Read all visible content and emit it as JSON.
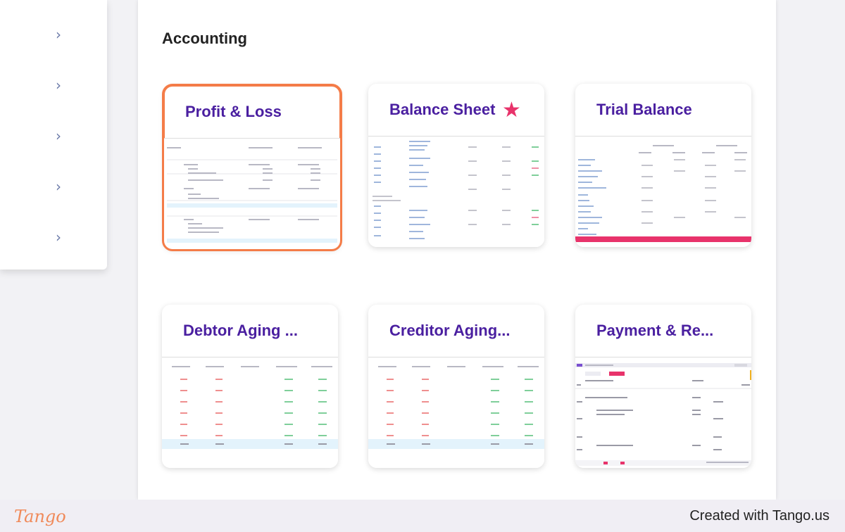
{
  "section": {
    "title": "Accounting"
  },
  "sidebar": {
    "chevron_glyph": "›",
    "chevron_icon": "chevron-right-icon",
    "count": 5
  },
  "cards": [
    {
      "name": "profit-loss",
      "title": "Profit & Loss",
      "selected": true,
      "starred": false
    },
    {
      "name": "balance-sheet",
      "title": "Balance Sheet",
      "selected": false,
      "starred": true
    },
    {
      "name": "trial-balance",
      "title": "Trial Balance",
      "selected": false,
      "starred": false
    },
    {
      "name": "debtor-aging",
      "title": "Debtor Aging ...",
      "selected": false,
      "starred": false
    },
    {
      "name": "creditor-aging",
      "title": "Creditor Aging...",
      "selected": false,
      "starred": false
    },
    {
      "name": "payment-receipt",
      "title": "Payment & Re...",
      "selected": false,
      "starred": false
    }
  ],
  "star_glyph": "★",
  "footer": {
    "brand": "Tango",
    "credit": "Created with Tango.us"
  },
  "colors": {
    "accent": "#f47c48",
    "title": "#4a1fa0",
    "star": "#e8336b",
    "brand": "#f08a5a"
  }
}
